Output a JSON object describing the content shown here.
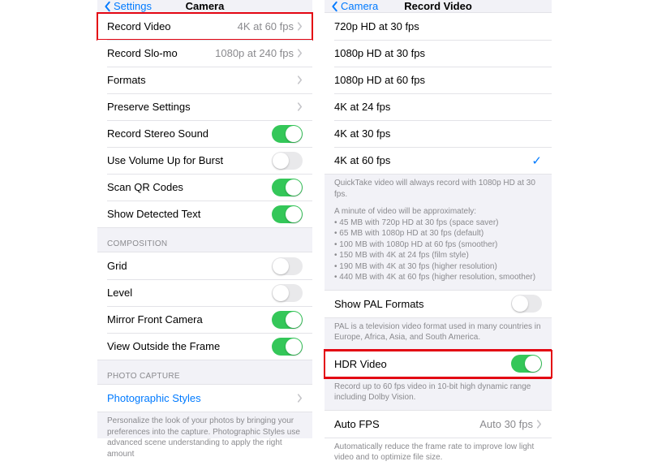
{
  "left": {
    "nav": {
      "back": "Settings",
      "title": "Camera"
    },
    "rows_main": [
      {
        "label": "Record Video",
        "value": "4K at 60 fps",
        "disclosure": true,
        "highlight": true
      },
      {
        "label": "Record Slo-mo",
        "value": "1080p at 240 fps",
        "disclosure": true
      },
      {
        "label": "Formats",
        "disclosure": true
      },
      {
        "label": "Preserve Settings",
        "disclosure": true
      },
      {
        "label": "Record Stereo Sound",
        "toggle": true
      },
      {
        "label": "Use Volume Up for Burst",
        "toggle": false
      },
      {
        "label": "Scan QR Codes",
        "toggle": true
      },
      {
        "label": "Show Detected Text",
        "toggle": true
      }
    ],
    "section_composition": "COMPOSITION",
    "rows_composition": [
      {
        "label": "Grid",
        "toggle": false
      },
      {
        "label": "Level",
        "toggle": false
      },
      {
        "label": "Mirror Front Camera",
        "toggle": true
      },
      {
        "label": "View Outside the Frame",
        "toggle": true
      }
    ],
    "section_photo_capture": "PHOTO CAPTURE",
    "rows_photo_capture": [
      {
        "label": "Photographic Styles",
        "link": true,
        "disclosure": true
      }
    ],
    "photo_capture_footer": "Personalize the look of your photos by bringing your preferences into the capture. Photographic Styles use advanced scene understanding to apply the right amount"
  },
  "right": {
    "nav": {
      "back": "Camera",
      "title": "Record Video"
    },
    "options": [
      {
        "label": "720p HD at 30 fps",
        "selected": false
      },
      {
        "label": "1080p HD at 30 fps",
        "selected": false
      },
      {
        "label": "1080p HD at 60 fps",
        "selected": false
      },
      {
        "label": "4K at 24 fps",
        "selected": false
      },
      {
        "label": "4K at 30 fps",
        "selected": false
      },
      {
        "label": "4K at 60 fps",
        "selected": true
      }
    ],
    "quicktake_note": "QuickTake video will always record with 1080p HD at 30 fps.",
    "size_header": "A minute of video will be approximately:",
    "size_lines": [
      "• 45 MB with 720p HD at 30 fps (space saver)",
      "• 65 MB with 1080p HD at 30 fps (default)",
      "• 100 MB with 1080p HD at 60 fps (smoother)",
      "• 150 MB with 4K at 24 fps (film style)",
      "• 190 MB with 4K at 30 fps (higher resolution)",
      "• 440 MB with 4K at 60 fps (higher resolution, smoother)"
    ],
    "pal": {
      "label": "Show PAL Formats",
      "toggle": false
    },
    "pal_footer": "PAL is a television video format used in many countries in Europe, Africa, Asia, and South America.",
    "hdr": {
      "label": "HDR Video",
      "toggle": true,
      "highlight": true
    },
    "hdr_footer": "Record up to 60 fps video in 10-bit high dynamic range including Dolby Vision.",
    "autofps": {
      "label": "Auto FPS",
      "value": "Auto 30 fps",
      "disclosure": true
    },
    "autofps_footer": "Automatically reduce the frame rate to improve low light video and to optimize file size."
  }
}
